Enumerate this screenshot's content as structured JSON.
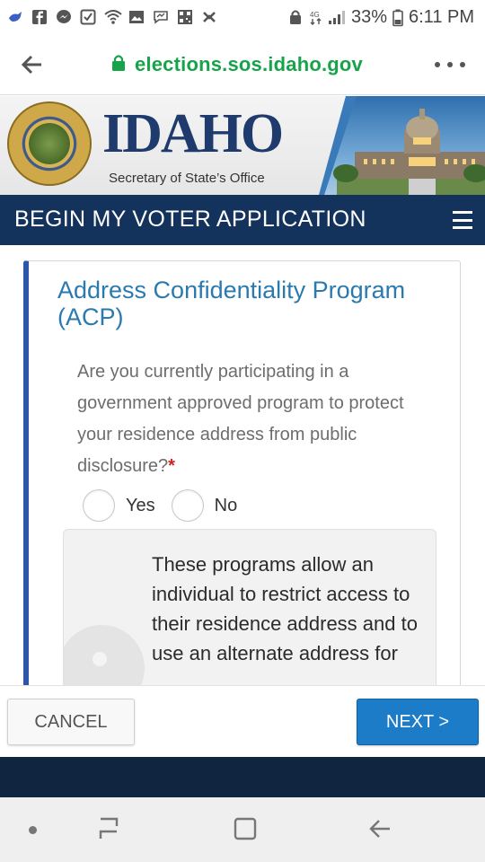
{
  "status_bar": {
    "battery_percent": "33%",
    "time": "6:11 PM",
    "left_icons": [
      "bird-icon",
      "facebook-icon",
      "messenger-icon",
      "checkbox-icon",
      "wifi-icon",
      "image-icon",
      "chat-icon",
      "qr-icon",
      "puzzle-icon"
    ],
    "right_icons": [
      "lock-icon",
      "network-4g-icon",
      "signal-icon",
      "battery-icon"
    ]
  },
  "browser": {
    "url": "elections.sos.idaho.gov",
    "secure": true
  },
  "banner": {
    "title": "IDAHO",
    "subtitle": "Secretary of State’s Office",
    "seal_text": "GREAT SEAL OF THE STATE OF IDAHO"
  },
  "nav": {
    "title": "BEGIN MY VOTER APPLICATION"
  },
  "section": {
    "title": "Address Confidentiality Program (ACP)",
    "question": "Are you currently participating in a government approved program to protect your residence address from public disclosure?",
    "required_marker": "*",
    "options": [
      "Yes",
      "No"
    ],
    "info_text": "These programs allow an individual to restrict access to their residence address and to use an alternate address for"
  },
  "footer": {
    "cancel_label": "CANCEL",
    "next_label": "NEXT >"
  },
  "colors": {
    "nav_bg": "#14335c",
    "accent_blue": "#2d55a8",
    "title_blue": "#2a7ab0",
    "next_button": "#1c7cc8",
    "url_green": "#17a34a",
    "required_red": "#d62020"
  }
}
